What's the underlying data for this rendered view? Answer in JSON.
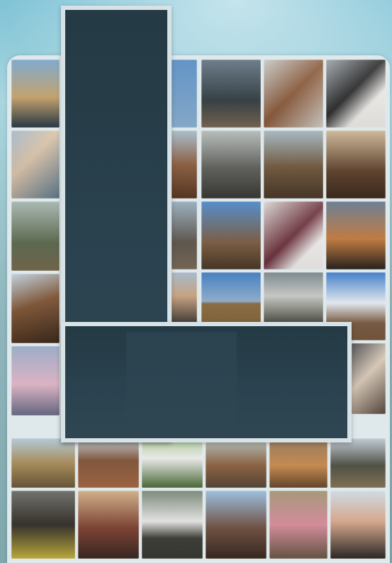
{
  "scene": {
    "description_hidden": "",
    "letter": "L",
    "colors": {
      "sky_top": "#7fc3d6",
      "board": "#dfe8ea",
      "letter_fill": "#2b4350",
      "letter_border": "#d7e2e6"
    }
  },
  "tiles": [
    {
      "name": "photo-lake-sunset",
      "bg": "linear-gradient(180deg,#6f9fc7,#c9a46b 55%,#2b3b4a)"
    },
    {
      "name": "photo-children",
      "bg": "linear-gradient(135deg,#9db4c4,#d9c1a6 40%,#5e7a8e)"
    },
    {
      "name": "photo-cattle-trees",
      "bg": "linear-gradient(180deg,#9fb0a8,#58664a 60%,#7a6c52)"
    },
    {
      "name": "photo-brown-bull",
      "bg": "linear-gradient(160deg,#b7cbd9,#7a4e2c 45%,#3b2a1e)"
    },
    {
      "name": "photo-girl-pink-dress",
      "bg": "linear-gradient(180deg,#8fa2bf,#e3b7c9 55%,#6b6e8a)"
    },
    {
      "name": "photo-field-horizon",
      "bg": "linear-gradient(180deg,#a9c2cf,#a88a56 50%,#6e5a3a)"
    },
    {
      "name": "photo-cows-yellow-flowers",
      "bg": "linear-gradient(180deg,#5f5f5a,#2b2620 50%,#c9b640)"
    },
    {
      "name": "photo-sky-top",
      "bg": "linear-gradient(180deg,#4f86bf,#8fb6d8)"
    },
    {
      "name": "photo-people-truck",
      "bg": "linear-gradient(180deg,#5a6c7b,#2f3a3f 60%,#7b6a56)"
    },
    {
      "name": "photo-saddle-closeup",
      "bg": "linear-gradient(135deg,#c3c6c4,#8a5a3a 50%,#d6d2cc)"
    },
    {
      "name": "photo-dog-black-white",
      "bg": "linear-gradient(135deg,#9aa3a8,#2a2a2a 45%,#f0efec 70%)"
    },
    {
      "name": "photo-horse-head",
      "bg": "linear-gradient(180deg,#9eb5c6,#8a5a3a 50%,#5a3a24)"
    },
    {
      "name": "photo-stable-interior",
      "bg": "linear-gradient(180deg,#aeb5b3,#5b5c57 55%,#3a3a36)"
    },
    {
      "name": "photo-rider-horse",
      "bg": "linear-gradient(180deg,#9cb0b8,#6b5236 55%,#4b3a2a)"
    },
    {
      "name": "photo-dog-horses",
      "bg": "linear-gradient(180deg,#c7b08e,#5b3c26 60%,#3d2c20)"
    },
    {
      "name": "photo-people-group-strip",
      "bg": "linear-gradient(180deg,#8fa6b8,#5a5248 60%,#7d6e5c)"
    },
    {
      "name": "photo-horse-riders-sky",
      "bg": "linear-gradient(180deg,#3f7fc4,#7a5a3e 60%,#4a3a28)"
    },
    {
      "name": "photo-man-hugging-dog",
      "bg": "linear-gradient(135deg,#d8d3cf,#6b2f3a 50%,#f2f0ee 75%)"
    },
    {
      "name": "photo-sunset-landscape",
      "bg": "linear-gradient(180deg,#5a6e86,#c57a3a 55%,#2a2420)"
    },
    {
      "name": "photo-man-hat",
      "bg": "linear-gradient(180deg,#9bb2c4,#c9a27e 45%,#3e3a36)"
    },
    {
      "name": "photo-flat-plain-tree",
      "bg": "linear-gradient(180deg,#2f6fb8,#8fb0d0 55%,#8a6a3e 60%)"
    },
    {
      "name": "photo-group-house",
      "bg": "linear-gradient(180deg,#6c7a80,#c9cbc6 45%,#4a4a40)"
    },
    {
      "name": "photo-blue-sky-clouds",
      "bg": "linear-gradient(180deg,#2c6fc2,#e8eef5 45%,#7a5a40 75%)"
    },
    {
      "name": "photo-person-sack",
      "bg": "linear-gradient(135deg,#3d3d40,#d8c8b6 45%,#5a4a40)"
    },
    {
      "name": "photo-horse-red-dirt",
      "bg": "linear-gradient(180deg,#b9c4ca,#7c4e33 45%,#a86c45)"
    },
    {
      "name": "photo-girl-bucket",
      "bg": "linear-gradient(180deg,#9fc08a,#f0f0ee 40%,#4f6e3a)"
    },
    {
      "name": "photo-cows-brown",
      "bg": "linear-gradient(180deg,#aab9b6,#8a5d3a 55%,#5a4a3a)"
    },
    {
      "name": "photo-rodeo-dust",
      "bg": "linear-gradient(180deg,#8a6a4a,#c98a4a 55%,#6b4a2e)"
    },
    {
      "name": "photo-horse-parade",
      "bg": "linear-gradient(180deg,#b8c6cf,#4a4a3e 55%,#8a7a5a)"
    },
    {
      "name": "photo-machinery-sunset",
      "bg": "linear-gradient(180deg,#c9a57a,#7a3a2a 55%,#3a2a24)"
    },
    {
      "name": "photo-cow-white",
      "bg": "linear-gradient(180deg,#6b7a6a,#e8e8e6 45%,#3a3a34 70%)"
    },
    {
      "name": "photo-boy-on-horse",
      "bg": "linear-gradient(180deg,#8fb6d8,#6b4a3a 55%,#3a2a22)"
    },
    {
      "name": "photo-girl-pink-stripes",
      "bg": "linear-gradient(180deg,#9a8a6a,#d98a9a 50%,#6a5a46)"
    },
    {
      "name": "photo-couple-aprons",
      "bg": "linear-gradient(180deg,#c9d6df,#d9a88a 45%,#2e2a28)"
    },
    {
      "name": "photo-group-shed",
      "bg": "linear-gradient(180deg,#b9c2c6,#5a4a3a 50%,#2a2624)"
    },
    {
      "name": "photo-butterfly",
      "bg": "radial-gradient(circle at 55% 55%, #0e0e10 0 32%, #6fae3a 33% 100%)"
    }
  ]
}
